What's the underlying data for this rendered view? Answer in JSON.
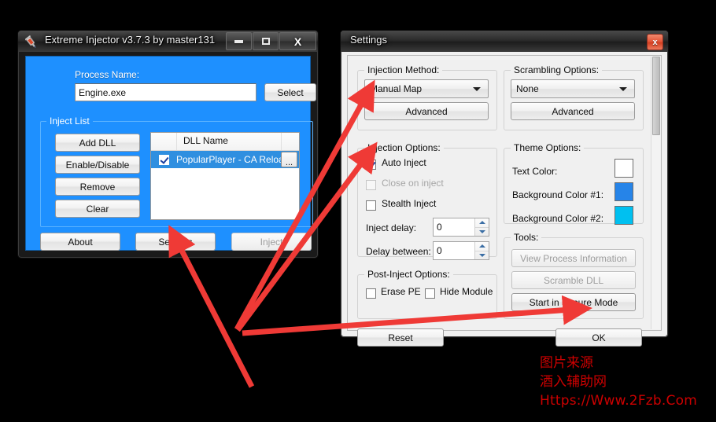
{
  "injector_window": {
    "title": "Extreme Injector v3.7.3 by master131",
    "icon": "syringe-icon",
    "controls": {
      "minimize": "minimize-icon",
      "maximize": "maximize-icon",
      "close": "X"
    },
    "process_label": "Process Name:",
    "process_value": "Engine.exe",
    "process_placeholder": "Process Name",
    "select_button": "Select",
    "inject_list": {
      "group_title": "Inject List",
      "buttons": [
        "Add DLL",
        "Enable/Disable",
        "Remove",
        "Clear"
      ],
      "column_header": "DLL Name",
      "rows": [
        {
          "checked": true,
          "name": "PopularPlayer - CA Reloaded...",
          "more": "..."
        }
      ]
    },
    "bottom_buttons": [
      {
        "label": "About",
        "enabled": true
      },
      {
        "label": "Settings",
        "enabled": true
      },
      {
        "label": "Inject",
        "enabled": false
      }
    ],
    "theme": {
      "background1": "#1e90ff",
      "background2": "#00bff0",
      "text": "#ffffff"
    }
  },
  "settings_window": {
    "title": "Settings",
    "close_button": "x",
    "injection_method": {
      "group_title": "Injection Method:",
      "selected": "Manual Map",
      "advanced_button": "Advanced"
    },
    "scrambling_options": {
      "group_title": "Scrambling Options:",
      "selected": "None",
      "advanced_button": "Advanced"
    },
    "injection_options": {
      "group_title": "Injection Options:",
      "checkboxes": [
        {
          "label": "Auto Inject",
          "checked": true,
          "enabled": true
        },
        {
          "label": "Close on inject",
          "checked": false,
          "enabled": false
        },
        {
          "label": "Stealth Inject",
          "checked": false,
          "enabled": true
        }
      ],
      "inject_delay_label": "Inject delay:",
      "inject_delay_value": "0",
      "delay_between_label": "Delay between:",
      "delay_between_value": "0"
    },
    "post_inject_options": {
      "group_title": "Post-Inject Options:",
      "checkboxes": [
        {
          "label": "Erase PE",
          "checked": false
        },
        {
          "label": "Hide Module",
          "checked": false
        }
      ]
    },
    "theme_options": {
      "group_title": "Theme Options:",
      "rows": [
        {
          "label": "Text Color:",
          "color": "#ffffff"
        },
        {
          "label": "Background Color #1:",
          "color": "#2684e8"
        },
        {
          "label": "Background Color #2:",
          "color": "#00c0f0"
        }
      ]
    },
    "tools": {
      "group_title": "Tools:",
      "buttons": [
        {
          "label": "View Process Information",
          "enabled": false
        },
        {
          "label": "Scramble DLL",
          "enabled": false
        },
        {
          "label": "Start in Secure Mode",
          "enabled": true
        }
      ]
    },
    "footer_buttons": [
      {
        "label": "Reset",
        "enabled": true
      },
      {
        "label": "OK",
        "enabled": true
      }
    ]
  },
  "annotations": {
    "color": "#ef3a36",
    "arrows": [
      {
        "name": "arrow-to-injection-method",
        "target": "Manual Map dropdown"
      },
      {
        "name": "arrow-to-auto-inject",
        "target": "Auto Inject checkbox"
      },
      {
        "name": "arrow-to-settings-button",
        "target": "Settings button"
      },
      {
        "name": "arrow-to-ok-button",
        "target": "OK button"
      }
    ]
  },
  "watermark": {
    "line1": "图片来源",
    "line2": "酒入辅助网",
    "line3": "Https://Www.2Fzb.Com",
    "color": "#cc0000"
  }
}
